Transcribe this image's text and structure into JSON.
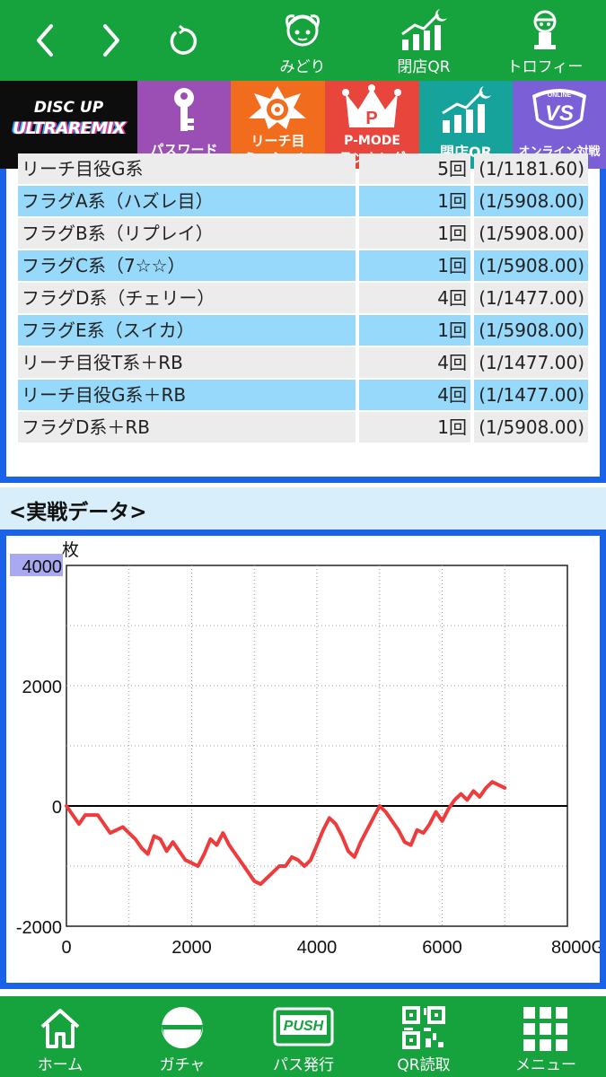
{
  "topnav": {
    "items": [
      {
        "label": "みどり",
        "icon": "midori-character-icon"
      },
      {
        "label": "閉店QR",
        "icon": "closing-qr-icon"
      },
      {
        "label": "トロフィー",
        "icon": "trophy-icon"
      }
    ]
  },
  "banner": {
    "logo_top": "DISC UP",
    "logo_bottom": "ULTRAREMIX",
    "items": [
      {
        "label": "パスワード",
        "color": "#9b4fb4"
      },
      {
        "label_line1": "リーチ目",
        "label_line2": "ミッション",
        "color": "#f26c1e"
      },
      {
        "label_line1": "P-MODE",
        "label_line2": "ランキング",
        "color": "#e8453c"
      },
      {
        "label": "閉店QR",
        "color": "#16a39b"
      },
      {
        "label": "オンライン対戦",
        "color": "#7a5fd6",
        "badge": "ONLINE",
        "vs": "VS"
      }
    ]
  },
  "flags": {
    "partial_top": {
      "name": "リーチ目役G系",
      "count": "5回",
      "prob": "(1/1181.60)"
    },
    "rows": [
      {
        "name": "フラグA系（ハズレ目）",
        "count": "1回",
        "prob": "(1/5908.00)"
      },
      {
        "name": "フラグB系（リプレイ）",
        "count": "1回",
        "prob": "(1/5908.00)"
      },
      {
        "name": "フラグC系（7☆☆）",
        "count": "1回",
        "prob": "(1/5908.00)"
      },
      {
        "name": "フラグD系（チェリー）",
        "count": "4回",
        "prob": "(1/1477.00)"
      },
      {
        "name": "フラグE系（スイカ）",
        "count": "1回",
        "prob": "(1/5908.00)"
      },
      {
        "name": "リーチ目役T系＋RB",
        "count": "4回",
        "prob": "(1/1477.00)"
      },
      {
        "name": "リーチ目役G系＋RB",
        "count": "4回",
        "prob": "(1/1477.00)"
      },
      {
        "name": "フラグD系＋RB",
        "count": "1回",
        "prob": "(1/5908.00)"
      }
    ]
  },
  "section": {
    "title": "<実戦データ>"
  },
  "chart_data": {
    "type": "line",
    "ylabel": "枚",
    "xlabel": "",
    "x_unit": "G",
    "xlim": [
      0,
      8000
    ],
    "ylim": [
      -2000,
      4000
    ],
    "x_ticks": [
      "0",
      "2000",
      "4000",
      "6000",
      "8000G"
    ],
    "y_ticks": [
      "4000",
      "2000",
      "0",
      "-2000"
    ],
    "grid": true,
    "series_color": "#ef3b3b",
    "x": [
      0,
      200,
      300,
      500,
      700,
      800,
      900,
      1100,
      1200,
      1300,
      1400,
      1500,
      1600,
      1700,
      1800,
      1900,
      2000,
      2100,
      2200,
      2300,
      2400,
      2500,
      2600,
      2700,
      2800,
      2900,
      3000,
      3100,
      3200,
      3300,
      3400,
      3500,
      3600,
      3700,
      3800,
      3900,
      4000,
      4100,
      4200,
      4300,
      4400,
      4500,
      4600,
      4700,
      4800,
      4900,
      5000,
      5100,
      5200,
      5300,
      5400,
      5500,
      5600,
      5700,
      5800,
      5900,
      6000,
      6100,
      6200,
      6300,
      6400,
      6500,
      6600,
      6700,
      6800,
      6900,
      7000
    ],
    "y": [
      0,
      -300,
      -150,
      -150,
      -450,
      -400,
      -350,
      -550,
      -700,
      -800,
      -500,
      -550,
      -750,
      -600,
      -750,
      -900,
      -950,
      -1000,
      -800,
      -550,
      -650,
      -450,
      -650,
      -800,
      -950,
      -1100,
      -1250,
      -1300,
      -1200,
      -1100,
      -1000,
      -1000,
      -850,
      -900,
      -1000,
      -900,
      -650,
      -400,
      -200,
      -300,
      -500,
      -750,
      -850,
      -600,
      -400,
      -200,
      0,
      -100,
      -250,
      -400,
      -600,
      -650,
      -400,
      -450,
      -300,
      -100,
      -250,
      -50,
      100,
      200,
      100,
      250,
      150,
      300,
      400,
      350,
      300
    ]
  },
  "bottomnav": {
    "items": [
      {
        "label": "ホーム",
        "icon": "home-icon"
      },
      {
        "label": "ガチャ",
        "icon": "gacha-capsule-icon"
      },
      {
        "label": "パス発行",
        "icon": "push-pass-icon",
        "badge": "PUSH"
      },
      {
        "label": "QR読取",
        "icon": "qr-code-icon"
      },
      {
        "label": "メニュー",
        "icon": "menu-grid-icon"
      }
    ]
  }
}
